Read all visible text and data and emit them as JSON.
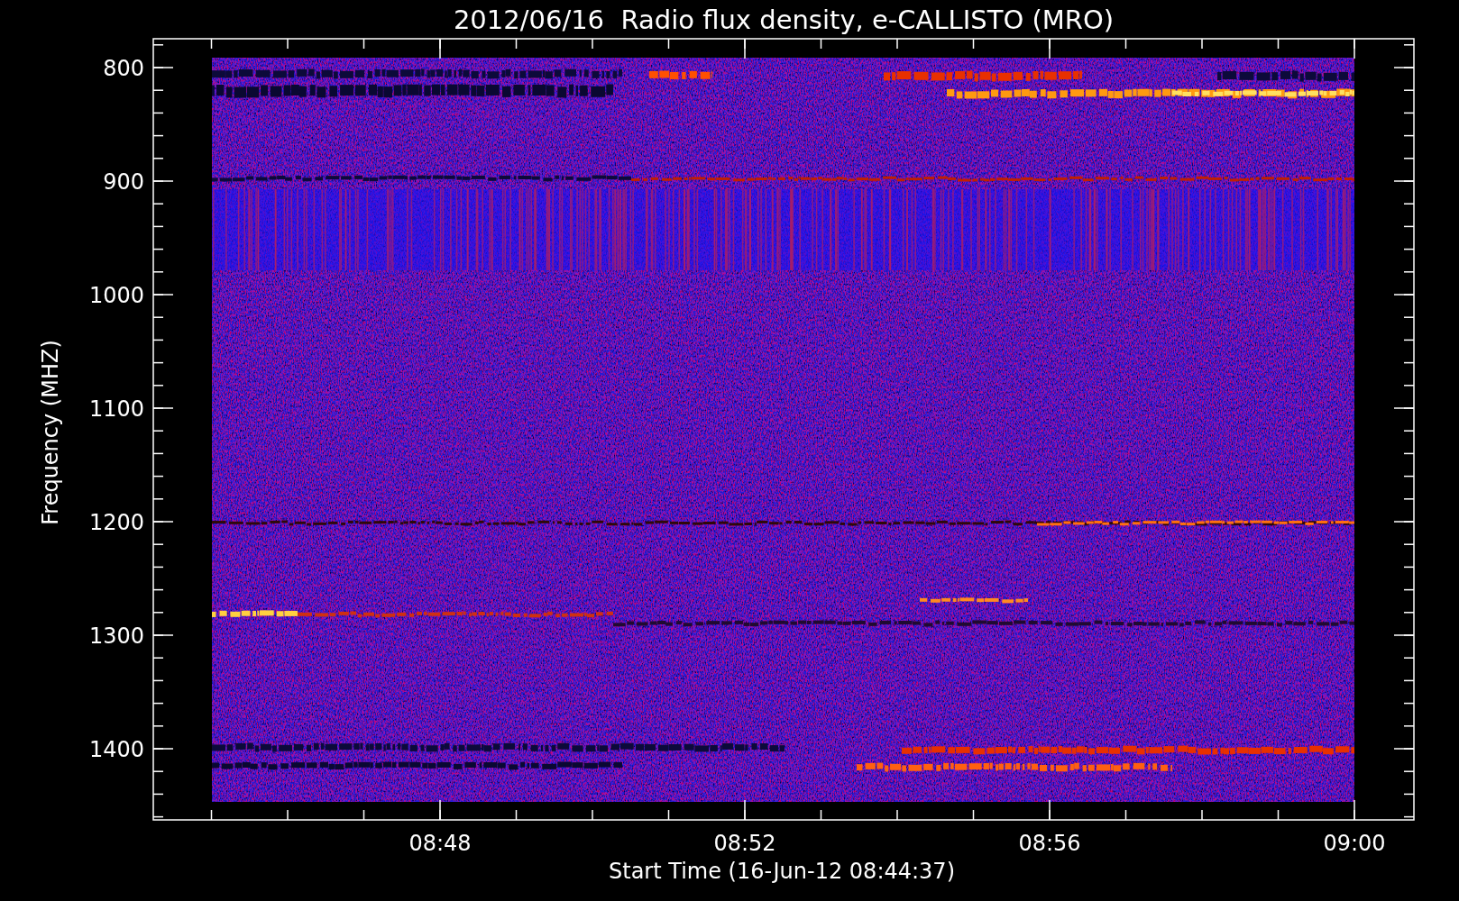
{
  "title": "2012/06/16  Radio flux density, e-CALLISTO (MRO)",
  "y_axis": {
    "label": "Frequency (MHZ)",
    "ticks": [
      "800",
      "900",
      "1000",
      "1100",
      "1200",
      "1300",
      "1400"
    ]
  },
  "x_axis": {
    "label": "Start Time (16-Jun-12 08:44:37)",
    "ticks": [
      "08:48",
      "08:52",
      "08:56",
      "09:00"
    ]
  }
}
